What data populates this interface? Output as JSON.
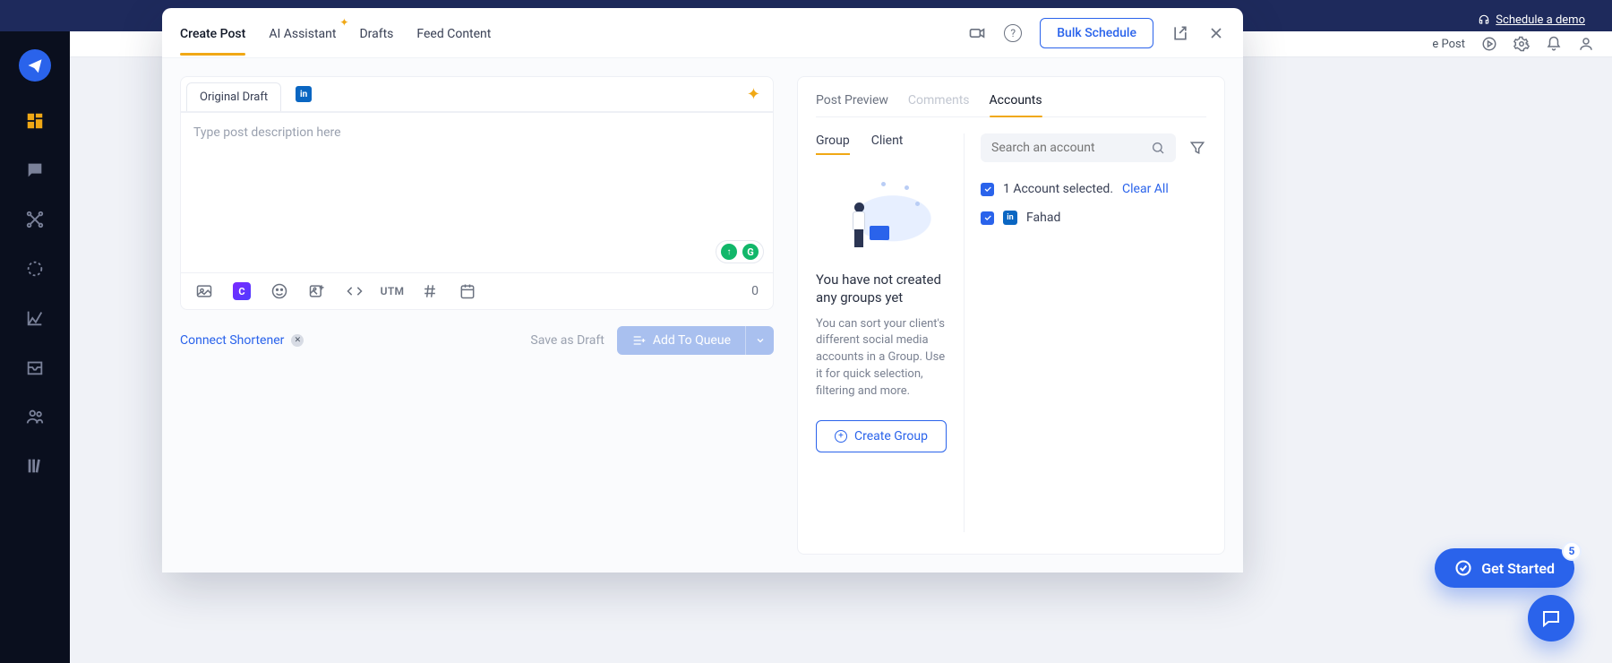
{
  "header": {
    "schedule_demo": "Schedule a demo",
    "e_post_partial": "e Post"
  },
  "modal": {
    "tabs": {
      "create_post": "Create Post",
      "ai_assistant": "AI Assistant",
      "drafts": "Drafts",
      "feed_content": "Feed Content"
    },
    "bulk_schedule": "Bulk Schedule"
  },
  "editor": {
    "original_draft": "Original Draft",
    "placeholder": "Type post description here",
    "char_count": "0",
    "utm_label": "UTM"
  },
  "below": {
    "connect_shortener": "Connect Shortener",
    "save_as_draft": "Save as Draft",
    "add_to_queue": "Add To Queue"
  },
  "right": {
    "tabs": {
      "post_preview": "Post Preview",
      "comments": "Comments",
      "accounts": "Accounts"
    },
    "subtabs": {
      "group": "Group",
      "client": "Client"
    },
    "empty": {
      "title": "You have not created any groups yet",
      "desc": "You can sort your client's different social media accounts in a Group. Use it for quick selection, filtering and more.",
      "create_group": "Create Group"
    },
    "search_placeholder": "Search an account",
    "selected_text": "1 Account selected. ",
    "clear_all": "Clear All",
    "account_name": "Fahad"
  },
  "floating": {
    "get_started": "Get Started",
    "badge": "5"
  }
}
